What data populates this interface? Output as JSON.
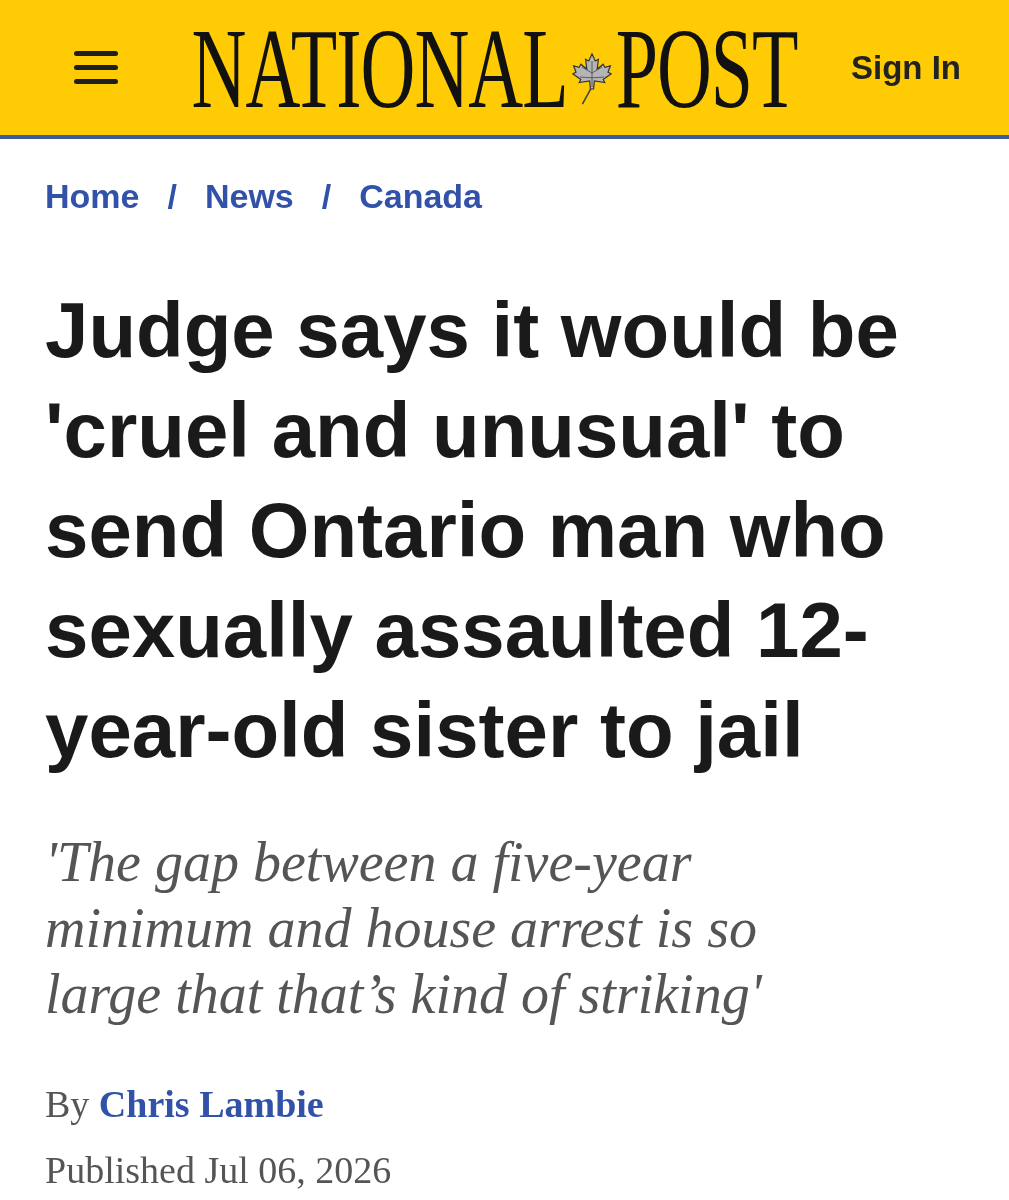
{
  "header": {
    "logo": [
      "NATIONAL",
      "POST"
    ],
    "sign_in": "Sign In"
  },
  "breadcrumbs": {
    "items": [
      "Home",
      "News",
      "Canada"
    ],
    "separators": [
      "/",
      "/"
    ]
  },
  "article": {
    "headline": "Judge says it would be 'cruel and unusual' to send Ontario man who sexually assaulted 12-year-old sister to jail",
    "subheadline": "'The gap between a five-year minimum and house arrest is so large that that’s kind of striking'",
    "byline": {
      "prefix": "By",
      "author": "Chris Lambie"
    },
    "published": "Published Jul 06, 2026"
  }
}
